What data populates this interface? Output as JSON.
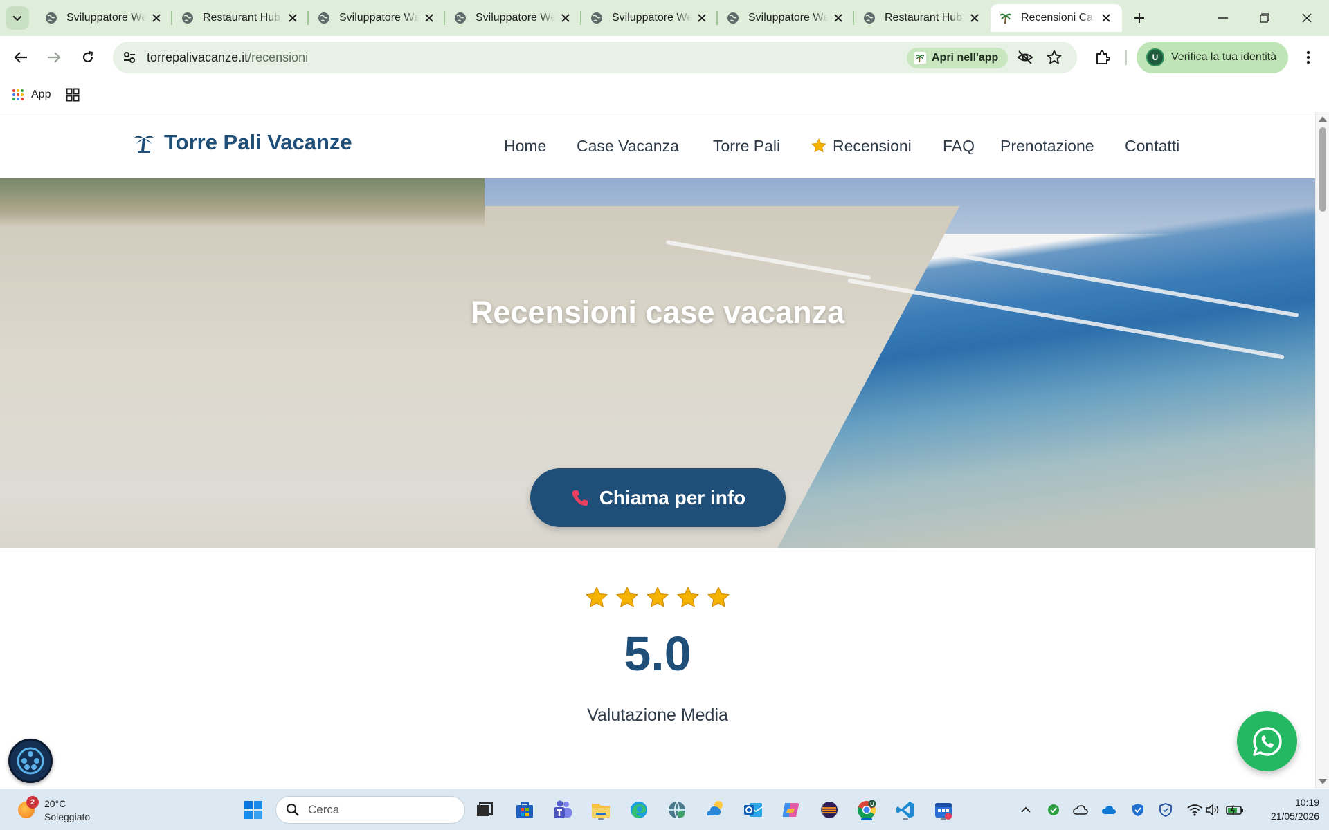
{
  "browser": {
    "tabs": [
      {
        "title": "Sviluppatore Web",
        "favicon": "globe-icon",
        "active": false
      },
      {
        "title": "Restaurant Hub",
        "favicon": "globe-icon",
        "active": false
      },
      {
        "title": "Sviluppatore Web",
        "favicon": "globe-icon",
        "active": false
      },
      {
        "title": "Sviluppatore Web",
        "favicon": "globe-icon",
        "active": false
      },
      {
        "title": "Sviluppatore Web",
        "favicon": "globe-icon",
        "active": false
      },
      {
        "title": "Sviluppatore Web",
        "favicon": "globe-icon",
        "active": false
      },
      {
        "title": "Restaurant Hub",
        "favicon": "globe-icon",
        "active": false
      },
      {
        "title": "Recensioni Case Vacanza",
        "favicon": "palm-tree-icon",
        "active": true
      }
    ],
    "url_domain": "torrepalivacanze.it",
    "url_path": "/recensioni",
    "open_in_app_label": "Apri nell'app",
    "verify_identity_label": "Verifica la tua identità",
    "profile_initial": "U",
    "bookmarks": {
      "apps_label": "App"
    }
  },
  "site": {
    "brand": "Torre Pali Vacanze",
    "nav": [
      "Home",
      "Case Vacanza",
      "Torre Pali",
      "Recensioni",
      "FAQ",
      "Prenotazione",
      "Contatti"
    ],
    "active_nav": "Recensioni",
    "hero_title": "Recensioni case vacanza",
    "cta_label": "Chiama per info",
    "rating_value": "5.0",
    "rating_stars": 5,
    "rating_label": "Valutazione Media",
    "colors": {
      "brand": "#1f4f78",
      "whatsapp": "#25b863",
      "star": "#f5b301"
    }
  },
  "taskbar": {
    "weather_temp": "20°C",
    "weather_condition": "Soleggiato",
    "weather_badge": "2",
    "search_placeholder": "Cerca",
    "time": "10:19",
    "date": "21/05/2026"
  }
}
